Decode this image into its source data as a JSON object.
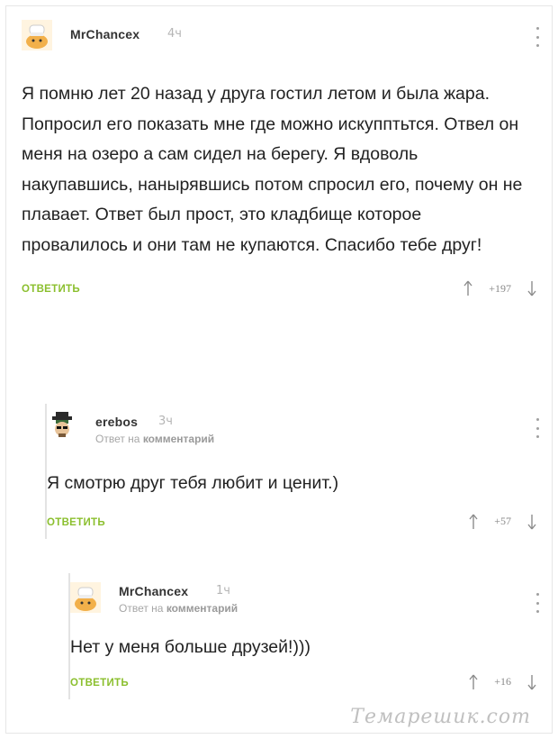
{
  "comments": [
    {
      "user": "MrChancex",
      "time": "4ч",
      "text": "Я помню лет 20 назад у друга гостил летом и была жара. Попросил его показать мне где можно искупптьтся. Отвел он меня на озеро а сам сидел на берегу. Я вдоволь накупавшись, нанырявшись потом спросил его, почему он не плавает. Ответ был прост, это кладбище которое провалилось и они там не купаются. Спасибо тебе друг!",
      "reply_label": "ОТВЕТИТЬ",
      "score": "+197",
      "avatar_icon": "chef-cat-avatar-icon"
    },
    {
      "user": "erebos",
      "time": "3ч",
      "reply_to_prefix": "Ответ на",
      "reply_to_target": "комментарий",
      "text": "Я смотрю друг тебя любит и ценит.)",
      "reply_label": "ОТВЕТИТЬ",
      "score": "+57",
      "avatar_icon": "hat-glasses-avatar-icon"
    },
    {
      "user": "MrChancex",
      "time": "1ч",
      "reply_to_prefix": "Ответ на",
      "reply_to_target": "комментарий",
      "text": "Нет у меня больше друзей!)))",
      "reply_label": "ОТВЕТИТЬ",
      "score": "+16",
      "avatar_icon": "chef-cat-avatar-icon"
    }
  ],
  "watermark": "Темарешик.com",
  "colors": {
    "accent": "#8bbf2e",
    "muted": "#a6a6a6",
    "text": "#222222"
  }
}
